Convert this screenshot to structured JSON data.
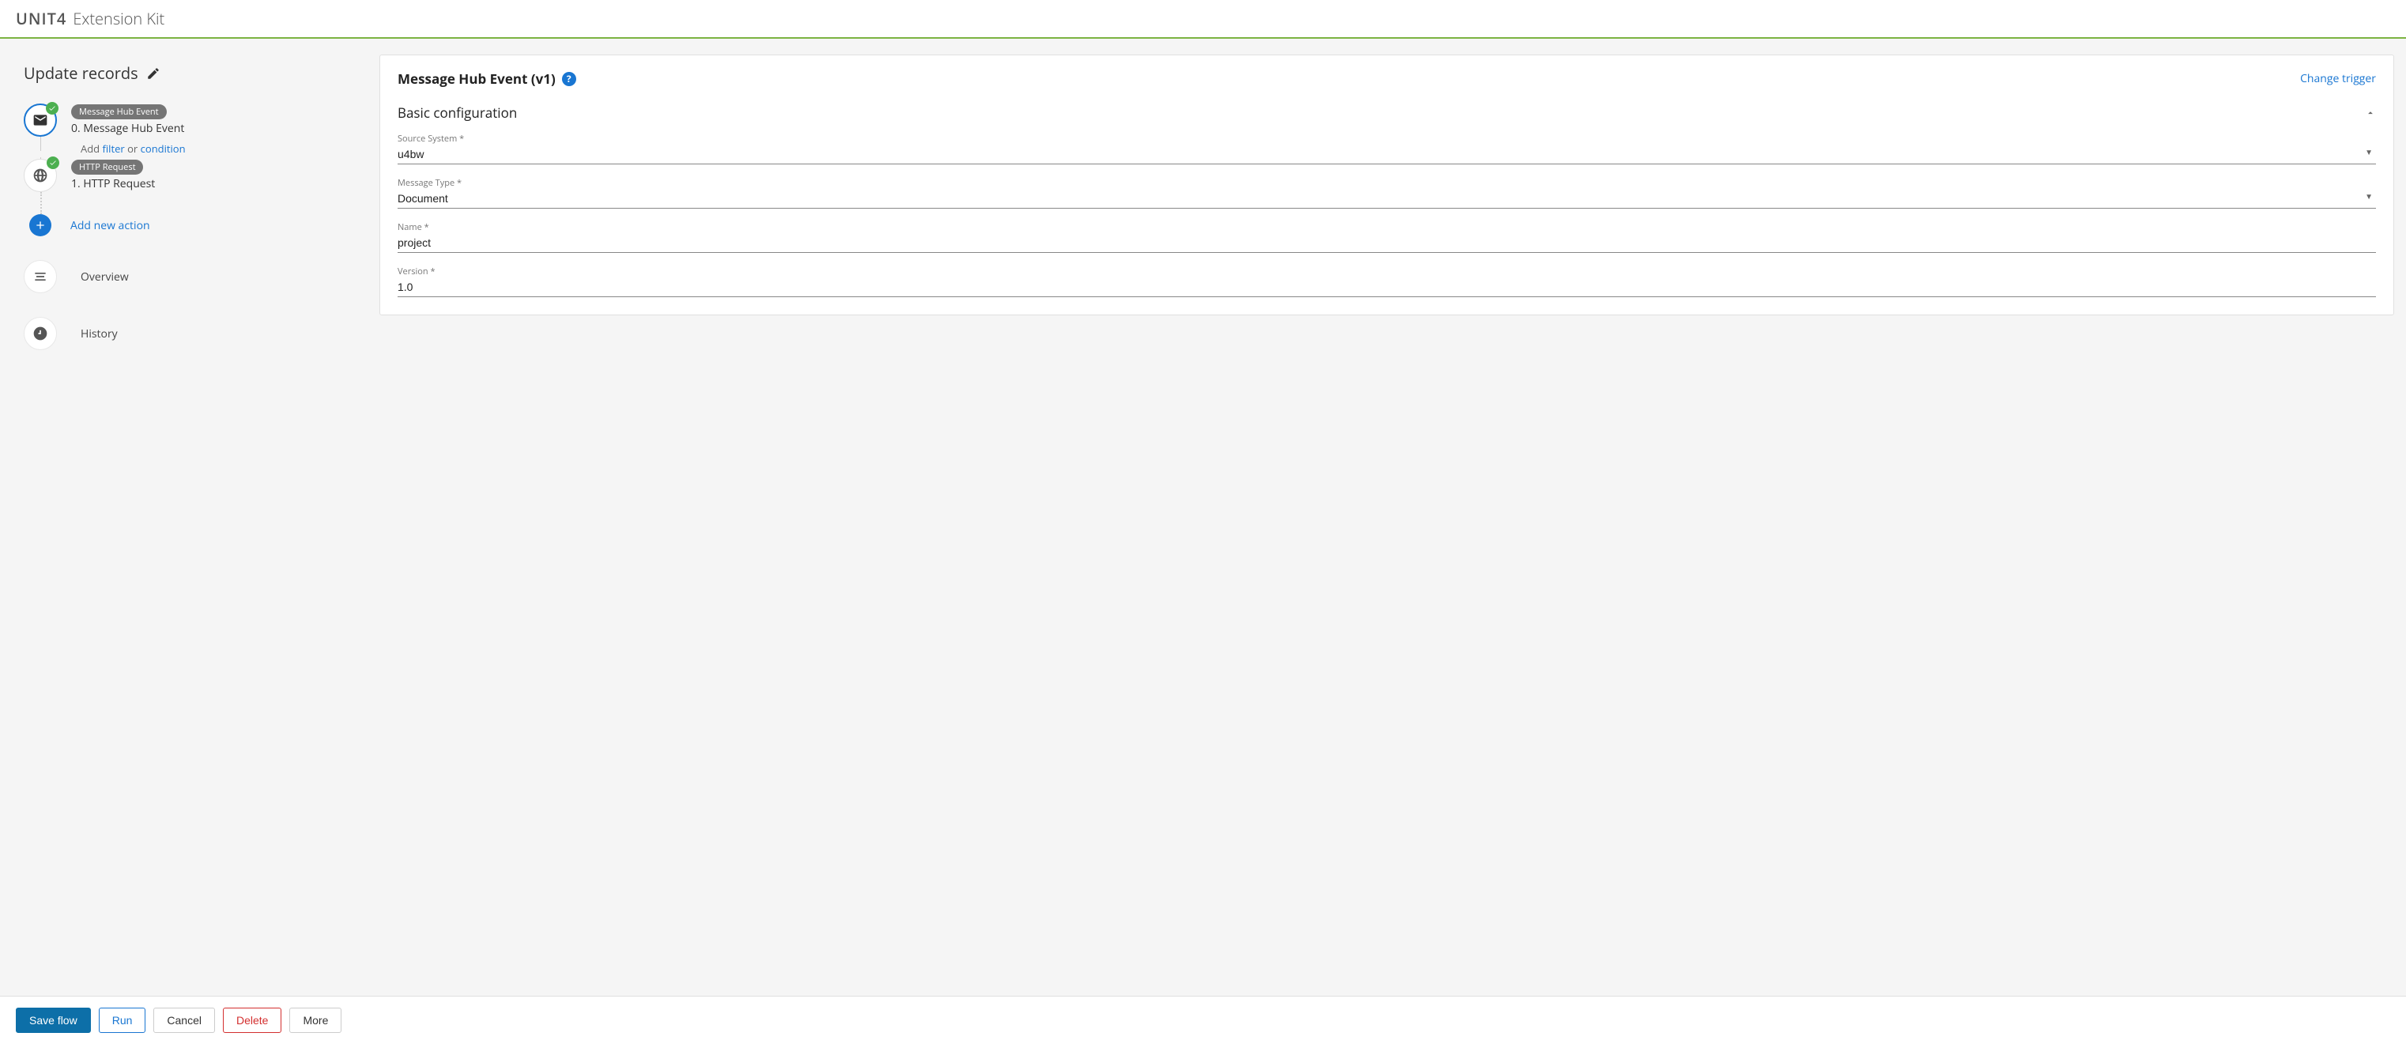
{
  "header": {
    "logo_text": "UNIT4",
    "product_name": "Extension Kit"
  },
  "sidebar": {
    "flow_title": "Update records",
    "steps": [
      {
        "badge": "Message Hub Event",
        "label": "0. Message Hub Event",
        "selected": true,
        "icon": "envelope"
      },
      {
        "badge": "HTTP Request",
        "label": "1. HTTP Request",
        "selected": false,
        "icon": "globe"
      }
    ],
    "add_row": {
      "prefix": "Add",
      "filter": "filter",
      "or": "or",
      "condition": "condition"
    },
    "add_action": "Add new action",
    "overview": "Overview",
    "history": "History"
  },
  "panel": {
    "title": "Message Hub Event (v1)",
    "change_trigger": "Change trigger",
    "section_title": "Basic configuration",
    "fields": {
      "source_system": {
        "label": "Source System *",
        "value": "u4bw"
      },
      "message_type": {
        "label": "Message Type *",
        "value": "Document"
      },
      "name": {
        "label": "Name *",
        "value": "project"
      },
      "version": {
        "label": "Version *",
        "value": "1.0"
      }
    }
  },
  "footer": {
    "save": "Save flow",
    "run": "Run",
    "cancel": "Cancel",
    "delete": "Delete",
    "more": "More"
  }
}
